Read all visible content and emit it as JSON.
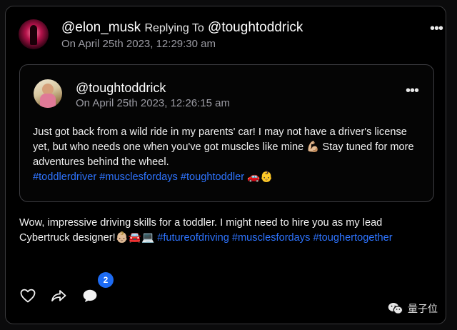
{
  "post": {
    "author": "@elon_musk",
    "replying_to_label": "Replying To",
    "replying_to_handle": "@toughtoddrick",
    "timestamp": "On April 25th 2023, 12:29:30 am",
    "text_before": "Wow, impressive driving skills for a toddler. I might need to hire you as my lead Cybertruck designer!👶🏼🚘💻 ",
    "hashtags": [
      "#futureofdriving",
      "#musclesfordays",
      "#toughertogether"
    ],
    "more_label": "•••",
    "comments_count": "2"
  },
  "quoted": {
    "author": "@toughtoddrick",
    "timestamp": "On April 25th 2023, 12:26:15 am",
    "text": "Just got back from a wild ride in my parents' car! I may not have a driver's license yet, but who needs one when you've got muscles like mine 💪🏼 Stay tuned for more adventures behind the wheel.",
    "hashtags": [
      "#toddlerdriver",
      "#musclesfordays",
      "#toughtoddler"
    ],
    "trailing_emoji": "🚗👶",
    "more_label": "•••"
  },
  "watermark": {
    "label": "量子位"
  },
  "colors": {
    "link": "#2e74ff",
    "badge": "#1d6bf3",
    "background": "#000000"
  },
  "icons": [
    "heart-icon",
    "share-icon",
    "comment-icon",
    "more-icon",
    "wechat-icon"
  ]
}
